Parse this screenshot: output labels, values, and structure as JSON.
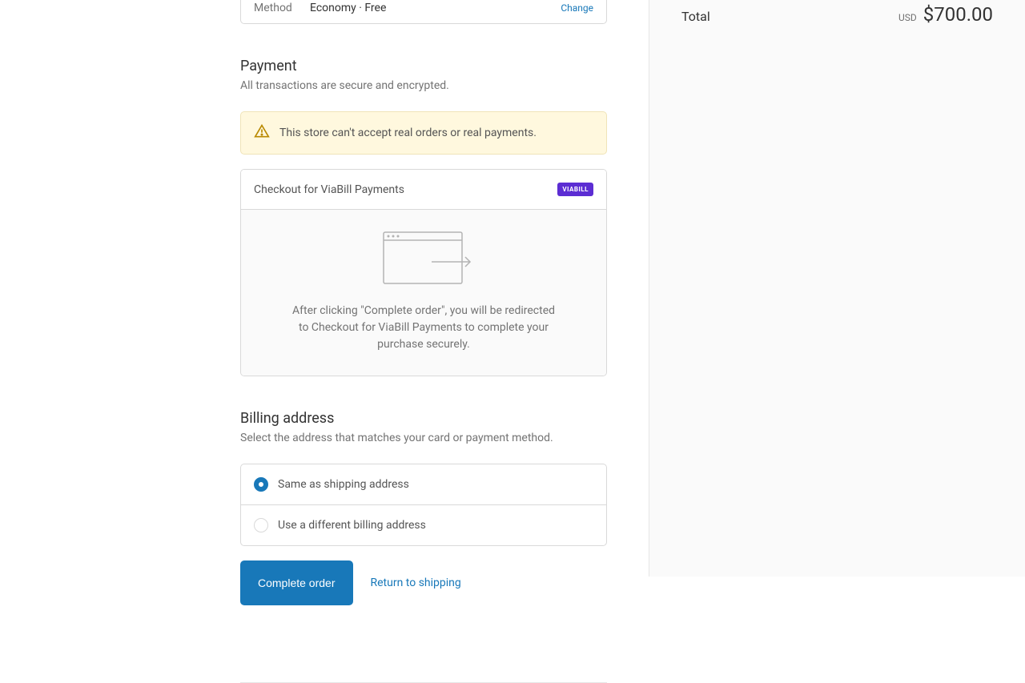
{
  "shipping": {
    "method_label": "Method",
    "method_value": "Economy · Free",
    "change_label": "Change"
  },
  "payment": {
    "title": "Payment",
    "subtitle": "All transactions are secure and encrypted.",
    "warning": "This store can't accept real orders or real payments.",
    "method_title": "Checkout for ViaBill Payments",
    "viabill_badge": "VIABILL",
    "redirect_desc": "After clicking \"Complete order\", you will be redirected to Checkout for ViaBill Payments to complete your purchase securely."
  },
  "billing": {
    "title": "Billing address",
    "subtitle": "Select the address that matches your card or payment method.",
    "option_same": "Same as shipping address",
    "option_different": "Use a different billing address"
  },
  "actions": {
    "complete": "Complete order",
    "return": "Return to shipping"
  },
  "summary": {
    "total_label": "Total",
    "currency": "USD",
    "total_amount": "$700.00"
  }
}
